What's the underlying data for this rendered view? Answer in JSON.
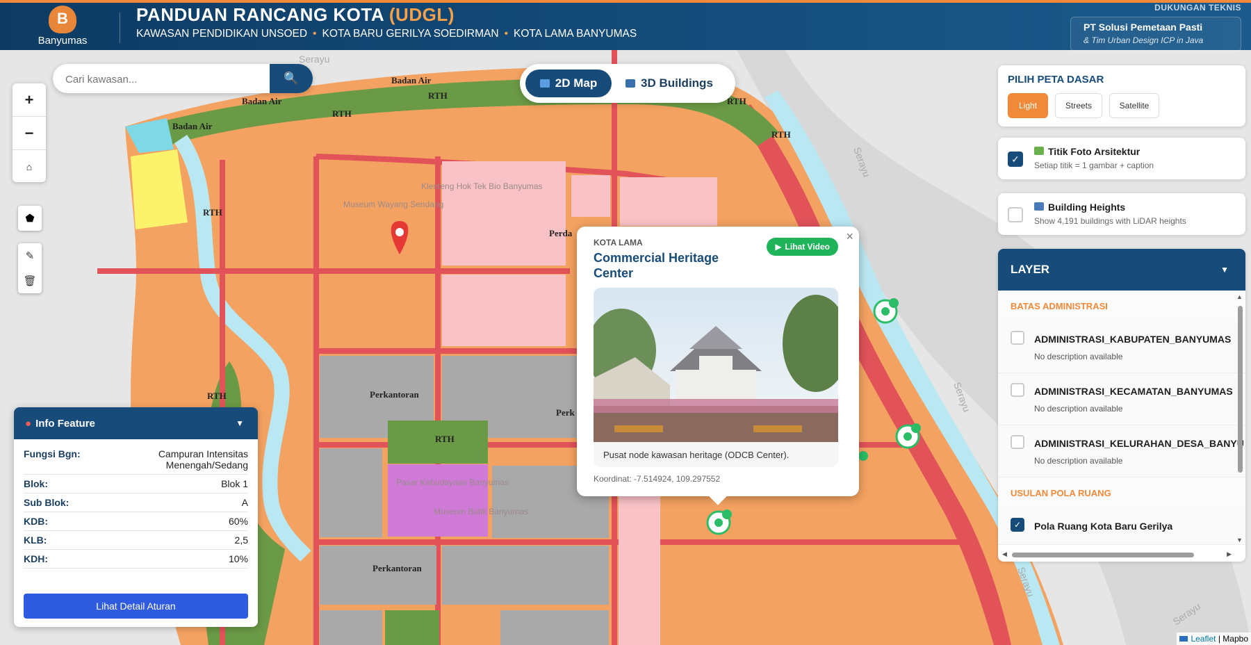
{
  "header": {
    "logo_text": "Banyumas",
    "logo_letter": "B",
    "title_main": "PANDUAN RANCANG KOTA ",
    "title_accent": "(UDGL)",
    "areas": [
      "KAWASAN PENDIDIKAN UNSOED",
      "KOTA BARU GERILYA SOEDIRMAN",
      "KOTA LAMA BANYUMAS"
    ],
    "separator": "•",
    "support_label": "DUKUNGAN TEKNIS",
    "support_name": "PT Solusi Pemetaan Pasti",
    "support_sub": "& Tim Urban Design ICP in Java"
  },
  "search": {
    "placeholder": "Cari kawasan...",
    "icon": "search-icon"
  },
  "view_toggle": {
    "map2d_label": "2D Map",
    "buildings3d_label": "3D Buildings",
    "active": "2D Map"
  },
  "zoom": {
    "in": "+",
    "out": "−",
    "home": "⌂"
  },
  "draw_tools": {
    "polygon": "⬟",
    "edit": "✎",
    "delete": "🗑"
  },
  "map_labels": {
    "road_badan_air": "Badan Air",
    "road_rth": "RTH",
    "perda": "Perda",
    "perkantoran": "Perkantoran",
    "perk": "Perk",
    "serayu": "Serayu",
    "faint_1": "Museum Wayang Sendang",
    "faint_2": "Klenteng Hok Tek Bio Banyumas",
    "faint_3": "Pasar Kebudayaan Banyumas",
    "faint_4": "Museum Batik Banyumas"
  },
  "info_feature": {
    "title": "Info Feature",
    "rows": [
      {
        "k": "Fungsi Bgn:",
        "v": "Campuran Intensitas Menengah/Sedang"
      },
      {
        "k": "Blok:",
        "v": "Blok 1"
      },
      {
        "k": "Sub Blok:",
        "v": "A"
      },
      {
        "k": "KDB:",
        "v": "60%"
      },
      {
        "k": "KLB:",
        "v": "2,5"
      },
      {
        "k": "KDH:",
        "v": "10%"
      }
    ],
    "button": "Lihat Detail Aturan"
  },
  "popup": {
    "category": "KOTA LAMA",
    "title": "Commercial Heritage Center",
    "video_button": "Lihat Video",
    "caption": "Pusat node kawasan heritage (ODCB Center).",
    "coordinates": "Koordinat: -7.514924, 109.297552",
    "close": "×"
  },
  "basemap": {
    "title": "PILIH PETA DASAR",
    "options": [
      "Light",
      "Streets",
      "Satellite"
    ],
    "selected": "Light"
  },
  "photo_points": {
    "title": "Titik Foto Arsitektur",
    "subtitle": "Setiap titik = 1 gambar + caption",
    "checked": true
  },
  "building_heights": {
    "title": "Building Heights",
    "subtitle": "Show 4,191 buildings with LiDAR heights",
    "checked": false
  },
  "layers": {
    "title": "LAYER",
    "sections": [
      {
        "name": "BATAS ADMINISTRASI",
        "items": [
          {
            "name": "ADMINISTRASI_KABUPATEN_BANYUMAS",
            "desc": "No description available",
            "checked": false
          },
          {
            "name": "ADMINISTRASI_KECAMATAN_BANYUMAS",
            "desc": "No description available",
            "checked": false
          },
          {
            "name": "ADMINISTRASI_KELURAHAN_DESA_BANYU",
            "desc": "No description available",
            "checked": false
          }
        ]
      },
      {
        "name": "USULAN POLA RUANG",
        "items": [
          {
            "name": "Pola Ruang Kota Baru Gerilya",
            "desc": "",
            "checked": true
          }
        ]
      }
    ]
  },
  "attribution": {
    "leaflet": "Leaflet",
    "sep": "|",
    "mapbox": "Mapbo"
  },
  "colors": {
    "header": "#174c7a",
    "accent": "#f08a3a",
    "mixed_use": "#f4a261",
    "commercial_pink": "#f9c2c6",
    "office_grey": "#a9a9a9",
    "green_space": "#6a9a45",
    "road": "#e15259",
    "river": "#9fdce8",
    "heritage_purple": "#d07ad8",
    "yellow_zone": "#fbf36b"
  }
}
